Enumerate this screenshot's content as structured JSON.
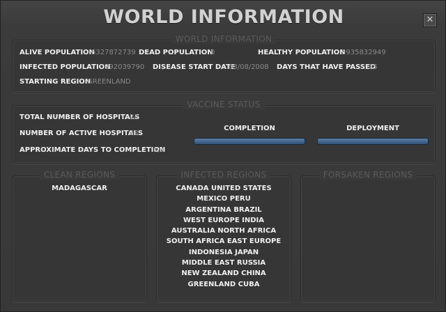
{
  "window": {
    "title": "WORLD INFORMATION",
    "close_glyph": "✕"
  },
  "world_info": {
    "title": "WORLD INFORMATION",
    "alive_population_label": "ALIVE POPULATION",
    "alive_population": "6327872739",
    "dead_population_label": "DEAD POPULATION",
    "dead_population": "0",
    "healthy_population_label": "HEALTHY POPULATION",
    "healthy_population": "5935832949",
    "infected_population_label": "INFECTED POPULATION",
    "infected_population": "392039790",
    "disease_start_date_label": "DISEASE START DATE",
    "disease_start_date": "03/08/2008",
    "days_passed_label": "DAYS THAT HAVE PASSED",
    "days_passed": "25",
    "starting_region_label": "STARTING REGION",
    "starting_region": "GREENLAND"
  },
  "vaccine": {
    "title": "VACCINE STATUS",
    "total_hospitals_label": "TOTAL NUMBER OF HOSPITALS",
    "total_hospitals": "24",
    "active_hospitals_label": "NUMBER OF ACTIVE HOSPITALS",
    "active_hospitals": "23",
    "days_to_completion_label": "APPROXIMATE DAYS TO COMPLETION",
    "days_to_completion": "n/a",
    "completion_label": "COMPLETION",
    "completion_progress": 0,
    "deployment_label": "DEPLOYMENT",
    "deployment_progress": 0,
    "bar_color": "#4a6d95"
  },
  "clean_regions": {
    "title": "CLEAN REGIONS",
    "rows": [
      "MADAGASCAR"
    ]
  },
  "infected_regions": {
    "title": "INFECTED REGIONS",
    "rows": [
      "CANADA  UNITED STATES",
      "MEXICO  PERU",
      "ARGENTINA  BRAZIL",
      "WEST EUROPE  INDIA",
      "AUSTRALIA  NORTH AFRICA",
      "SOUTH AFRICA  EAST EUROPE",
      "INDONESIA  JAPAN",
      "MIDDLE EAST  RUSSIA",
      "NEW ZEALAND  CHINA",
      "GREENLAND  CUBA"
    ]
  },
  "forsaken_regions": {
    "title": "FORSAKEN REGIONS",
    "rows": []
  }
}
